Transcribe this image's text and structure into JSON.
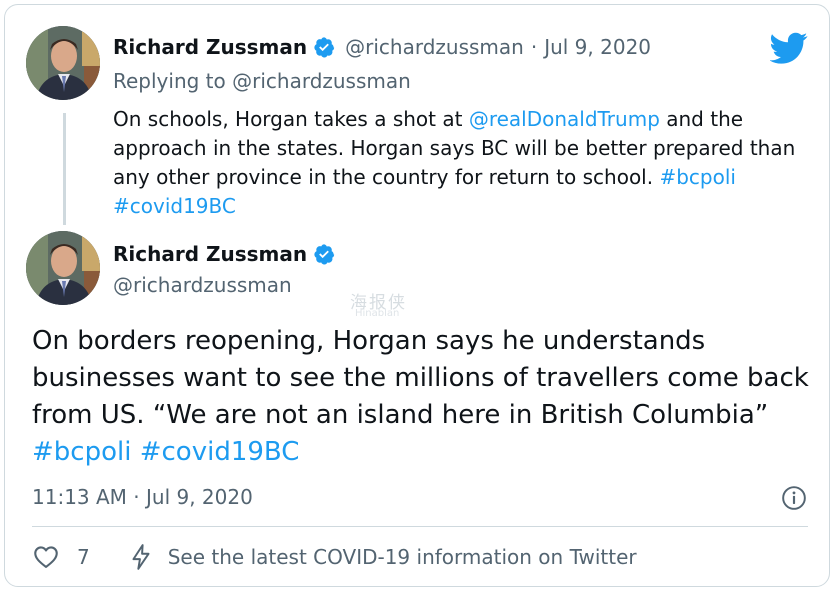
{
  "colors": {
    "twitter_blue": "#1d9bf0",
    "text_primary": "#0f1419",
    "text_secondary": "#536471",
    "border": "#cfd9de"
  },
  "parent_tweet": {
    "author_name": "Richard Zussman",
    "verified": true,
    "handle": "@richardzussman",
    "separator": "·",
    "date": "Jul 9, 2020",
    "replying_to": "Replying to @richardzussman",
    "text_segments": [
      {
        "text": "On schools, Horgan takes a shot at ",
        "link": false
      },
      {
        "text": "@realDonaldTrump",
        "link": true
      },
      {
        "text": " and the approach in the states. Horgan says BC will be better prepared than any other province in the country for return to school. ",
        "link": false
      },
      {
        "text": "#bcpoli",
        "link": true
      },
      {
        "text": " ",
        "link": false
      },
      {
        "text": "#covid19BC",
        "link": true
      }
    ]
  },
  "main_tweet": {
    "author_name": "Richard Zussman",
    "verified": true,
    "handle": "@richardzussman",
    "text_segments": [
      {
        "text": "On borders reopening, Horgan says he understands businesses want to see the millions of travellers come back from US. “We are not an island here in British Columbia” ",
        "link": false
      },
      {
        "text": "#bcpoli",
        "link": true
      },
      {
        "text": " ",
        "link": false
      },
      {
        "text": "#covid19BC",
        "link": true
      }
    ],
    "timestamp": "11:13 AM · Jul 9, 2020"
  },
  "actions": {
    "like_count": "7",
    "covid_info_label": "See the latest COVID-19 information on Twitter"
  },
  "watermark": {
    "main": "海报侠",
    "sub": "Hinablan"
  },
  "icons": {
    "logo": "twitter-bird-icon",
    "verified": "verified-badge-icon",
    "info": "info-icon",
    "like": "heart-icon",
    "covid": "lightning-icon"
  }
}
